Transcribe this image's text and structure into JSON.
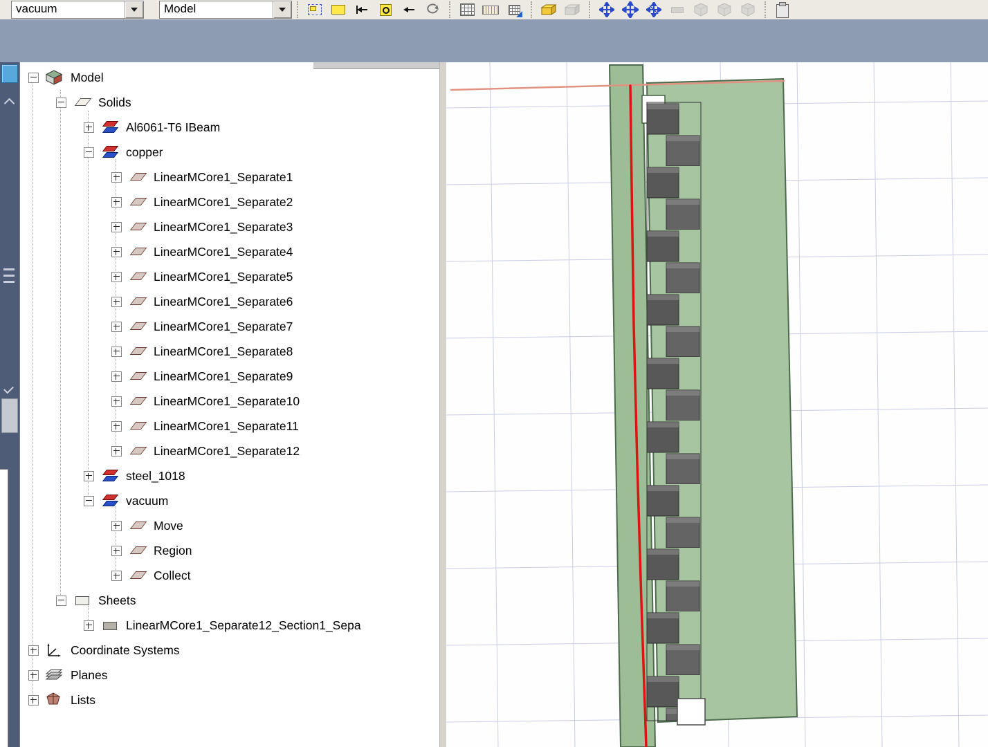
{
  "toolbar": {
    "material_combo": "vacuum",
    "view_combo": "Model",
    "icons": [
      "selection-box-icon",
      "draw-rectangle-icon",
      "align-to-bar-icon",
      "snap-center-icon",
      "arrow-left-icon",
      "rotate-icon",
      "grid-icon",
      "ruler-icon",
      "snap-grid-icon",
      "open-box-yellow-icon",
      "open-box-gray-icon",
      "move-arrows-icon",
      "move-arrows-large-icon",
      "move-arrows-alt-icon",
      "disabled-bar-icon",
      "gray-solid-icon-1",
      "gray-solid-icon-2",
      "gray-solid-icon-3",
      "clipboard-icon"
    ]
  },
  "sidebar": {
    "icons": [
      "dock-blue-tab-icon",
      "collapse-up-icon",
      "menu-lines-icon",
      "check-icon",
      "dock-panel-icon",
      "docked-white-strip"
    ]
  },
  "tree": {
    "items": [
      {
        "label": "Model",
        "icon": "model-3d-icon",
        "expanded": true,
        "level": 0
      },
      {
        "label": "Solids",
        "icon": "solids-icon",
        "expanded": true,
        "level": 1
      },
      {
        "label": "Al6061-T6 IBeam",
        "icon": "material-stack-icon",
        "expanded": false,
        "level": 2
      },
      {
        "label": "copper",
        "icon": "material-stack-icon",
        "expanded": true,
        "level": 2
      },
      {
        "label": "LinearMCore1_Separate1",
        "icon": "solid-parallelogram-icon",
        "expanded": false,
        "level": 3
      },
      {
        "label": "LinearMCore1_Separate2",
        "icon": "solid-parallelogram-icon",
        "expanded": false,
        "level": 3
      },
      {
        "label": "LinearMCore1_Separate3",
        "icon": "solid-parallelogram-icon",
        "expanded": false,
        "level": 3
      },
      {
        "label": "LinearMCore1_Separate4",
        "icon": "solid-parallelogram-icon",
        "expanded": false,
        "level": 3
      },
      {
        "label": "LinearMCore1_Separate5",
        "icon": "solid-parallelogram-icon",
        "expanded": false,
        "level": 3
      },
      {
        "label": "LinearMCore1_Separate6",
        "icon": "solid-parallelogram-icon",
        "expanded": false,
        "level": 3
      },
      {
        "label": "LinearMCore1_Separate7",
        "icon": "solid-parallelogram-icon",
        "expanded": false,
        "level": 3
      },
      {
        "label": "LinearMCore1_Separate8",
        "icon": "solid-parallelogram-icon",
        "expanded": false,
        "level": 3
      },
      {
        "label": "LinearMCore1_Separate9",
        "icon": "solid-parallelogram-icon",
        "expanded": false,
        "level": 3
      },
      {
        "label": "LinearMCore1_Separate10",
        "icon": "solid-parallelogram-icon",
        "expanded": false,
        "level": 3
      },
      {
        "label": "LinearMCore1_Separate11",
        "icon": "solid-parallelogram-icon",
        "expanded": false,
        "level": 3
      },
      {
        "label": "LinearMCore1_Separate12",
        "icon": "solid-parallelogram-icon",
        "expanded": false,
        "level": 3
      },
      {
        "label": "steel_1018",
        "icon": "material-stack-icon",
        "expanded": false,
        "level": 2
      },
      {
        "label": "vacuum",
        "icon": "material-stack-icon",
        "expanded": true,
        "level": 2
      },
      {
        "label": "Move",
        "icon": "solid-parallelogram-icon",
        "expanded": false,
        "level": 3
      },
      {
        "label": "Region",
        "icon": "solid-parallelogram-icon",
        "expanded": false,
        "level": 3
      },
      {
        "label": "Collect",
        "icon": "solid-parallelogram-icon",
        "expanded": false,
        "level": 3
      },
      {
        "label": "Sheets",
        "icon": "sheet-icon",
        "expanded": true,
        "level": 1
      },
      {
        "label": "LinearMCore1_Separate12_Section1_Sepa",
        "icon": "section-icon",
        "expanded": false,
        "level": 2
      },
      {
        "label": "Coordinate Systems",
        "icon": "axes-icon",
        "expanded": false,
        "level": 0
      },
      {
        "label": "Planes",
        "icon": "planes-icon",
        "expanded": false,
        "level": 0
      },
      {
        "label": "Lists",
        "icon": "lists-icon",
        "expanded": false,
        "level": 0
      }
    ]
  },
  "colors": {
    "header_band": "#8e9cb3",
    "dock_strip": "#4e5c78",
    "viewport_grid": "#c9cce7",
    "region_green": "#a7c5a0",
    "region_edge_green": "#4c6b4c",
    "core_gray": "#5a5a5a",
    "motion_line_red": "#dc1414",
    "boundary_salmon": "#e29283",
    "accent_yellow": "#ffe84a",
    "accent_blue": "#2a49c8"
  }
}
